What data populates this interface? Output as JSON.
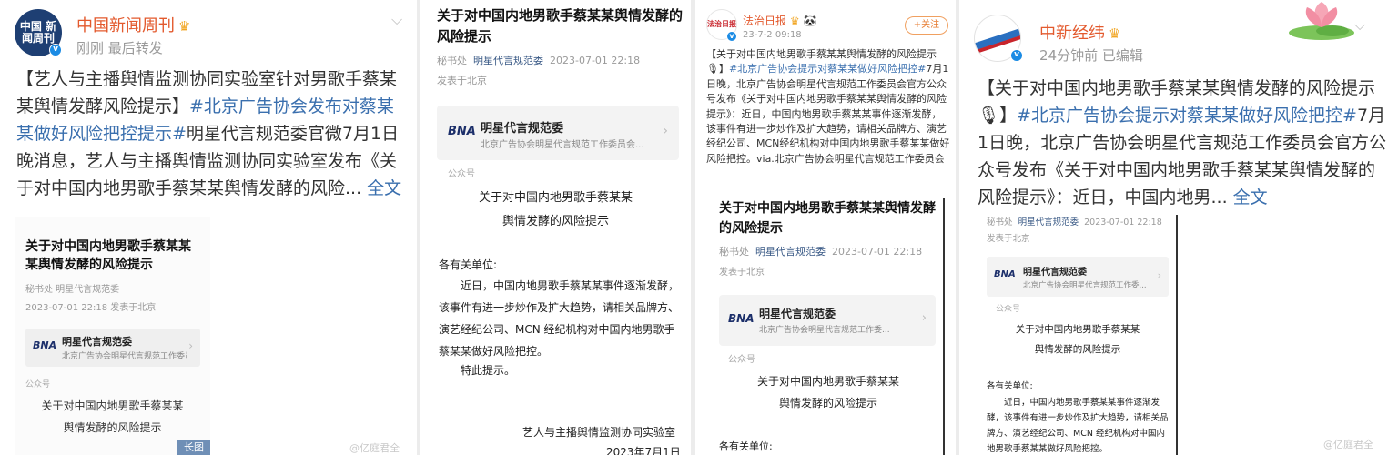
{
  "common": {
    "notice_title": "关于对中国内地男歌手蔡某某舆情发酵的风险提示",
    "meta_source": "秘书处",
    "meta_account": "明星代言规范委",
    "meta_datetime": "2023-07-01 22:18",
    "meta_location": "发表于北京",
    "card_logo": "BNA",
    "card_title": "明星代言规范委",
    "card_subtitle": "北京广告协会明星代言规范工作委员会...",
    "card_subtitle_short": "北京广告协会明星代言规范工作委...",
    "card_label": "公众号",
    "doc_line1": "关于对中国内地男歌手蔡某某",
    "doc_line2": "舆情发酵的风险提示",
    "greeting": "各有关单位:",
    "paragraph": "近日，中国内地男歌手蔡某某事件逐渐发酵，该事件有进一步炒作及扩大趋势，请相关品牌方、演艺经纪公司、MCN 经纪机构对中国内地男歌手蔡某某做好风险把控。",
    "special": "特此提示。",
    "signature": "艺人与主播舆情监测协同实验室",
    "sign_date": "2023年7月1日",
    "watermark": "@亿庭君全"
  },
  "panel1": {
    "avatar_text": "中国 新闻周刊",
    "account_name": "中国新闻周刊",
    "meta": "刚刚  最后转发",
    "body_prefix": "【艺人与主播舆情监测协同实验室针对男歌手蔡某某舆情发酵风险提示】",
    "topic": "#北京广告协会发布对蔡某某做好风险把控提示#",
    "body_suffix": "明星代言规范委官微7月1日晚消息，艺人与主播舆情监测协同实验室发布《关于对中国内地男歌手蔡某某舆情发酵的风险...",
    "more_label": "全文",
    "image_title": "关于对中国内地男歌手蔡某某某舆情发酵的风险提示",
    "image_meta_line1": "秘书处  明星代言规范委",
    "image_meta_line2": "2023-07-01 22:18  发表于北京",
    "long_image_label": "长图"
  },
  "panel2": {
    "meta_line": "秘书处  明星代言规范委  2023-07-01 22:18"
  },
  "panel3": {
    "avatar_text": "法治日报",
    "account_name": "法治日报",
    "time": "23-7-2 09:18",
    "follow_label": "+关注",
    "body_prefix": "【关于对中国内地男歌手蔡某某舆情发酵的风险提示",
    "topic": "#北京广告协会提示对蔡某某做好风险把控#",
    "body_suffix": "7月1日晚，北京广告协会明星代言规范工作委员会官方公众号发布《关于对中国内地男歌手蔡某某舆情发酵的风险提示》：近日，中国内地男歌手蔡某某事件逐渐发酵，该事件有进一步炒作及扩大趋势，请相关品牌方、演艺经纪公司、MCN经纪机构对中国内地男歌手蔡某某做好风险把控。via.北京广告协会明星代言规范工作委员会",
    "meta_line": "秘书处  明星代言规范委  2023-07-01 22:18"
  },
  "panel4": {
    "account_name": "中新经纬",
    "meta": "24分钟前   已编辑",
    "body_prefix": "【关于对中国内地男歌手蔡某某舆情发酵的风险提示",
    "topic": "#北京广告协会提示对蔡某某做好风险把控#",
    "body_suffix": "7月1日晚，北京广告协会明星代言规范工作委员会官方公众号发布《关于对中国内地男歌手蔡某某舆情发酵的风险提示》：近日，中国内地男...",
    "more_label": "全文",
    "meta_line": "秘书处  明星代言规范委  2023-07-01 22:18",
    "paragraph": "近日，中国内地男歌手蔡某某事件逐渐发酵，该事件有进一步炒作及扩大趋势，请相关品牌方、演艺经纪公司、MCN 经纪机构对中国内地男歌手蔡某某做好风险把控。"
  },
  "colors": {
    "account_name": "#e35a2e",
    "topic_link": "#3a6fae",
    "verified_badge": "#1b8be4"
  }
}
